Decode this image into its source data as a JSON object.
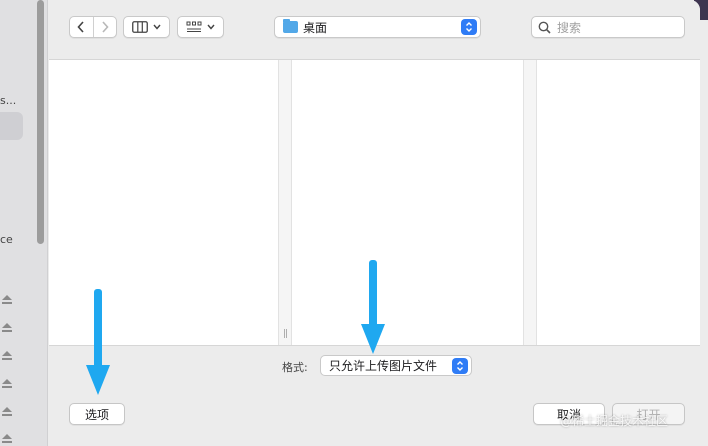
{
  "sidebar": {
    "fragments": [
      "s...",
      "ce"
    ]
  },
  "toolbar": {
    "back_glyph": "‹",
    "forward_glyph": "›",
    "location": "桌面",
    "search_placeholder": "搜索"
  },
  "format": {
    "label": "格式:",
    "value": "只允许上传图片文件"
  },
  "buttons": {
    "options": "选项",
    "cancel": "取消",
    "open": "打开"
  },
  "watermark": "@稀土掘金技术社区",
  "icons": {
    "back": "chevron-left-icon",
    "forward": "chevron-right-icon",
    "view": "columns-view-icon",
    "group": "grid-group-icon",
    "folder": "folder-icon",
    "search": "search-icon",
    "eject": "eject-icon"
  },
  "colors": {
    "accent": "#2f7cf6",
    "folder": "#52a8e8",
    "annotation_arrow": "#1fa8f0"
  }
}
